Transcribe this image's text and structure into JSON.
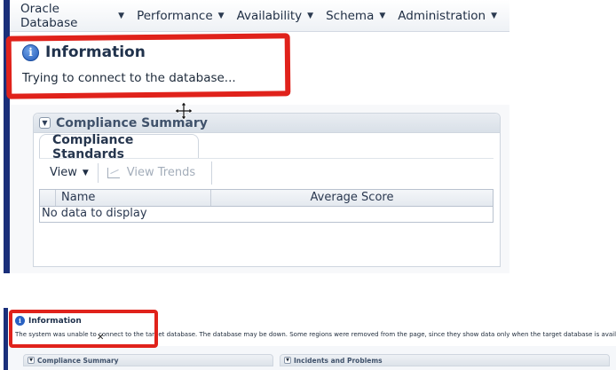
{
  "top": {
    "menu": [
      {
        "label": "Oracle Database"
      },
      {
        "label": "Performance"
      },
      {
        "label": "Availability"
      },
      {
        "label": "Schema"
      },
      {
        "label": "Administration"
      }
    ],
    "info_title": "Information",
    "info_message": "Trying to connect to the database...",
    "compliance": {
      "section_title": "Compliance Summary",
      "tab_label": "Compliance Standards",
      "view_label": "View",
      "trends_label": "View Trends",
      "columns": [
        "Name",
        "Average Score"
      ],
      "empty_message": "No data to display"
    }
  },
  "bottom": {
    "info_title": "Information",
    "info_message": "The system was unable to connect to the target database. The database may be down. Some regions were removed from the page, since they show data only when the target database is available.",
    "sections": [
      "Compliance Summary",
      "Incidents and Problems"
    ]
  },
  "colors": {
    "highlight_red": "#e0221b",
    "nav_bar_blue": "#1a2f7a",
    "info_icon_blue": "#2259b8"
  }
}
